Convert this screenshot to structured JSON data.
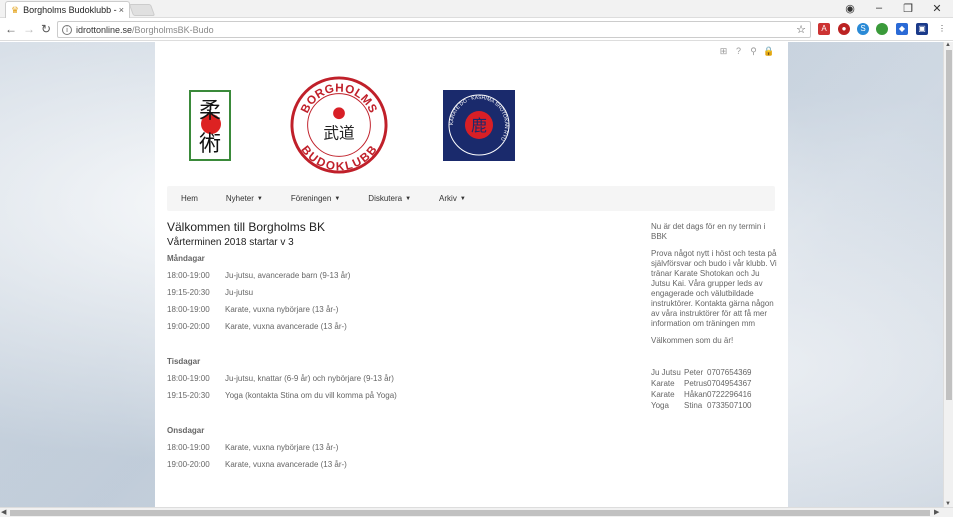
{
  "browser": {
    "tab_title": "Borgholms Budoklubb -",
    "tab_close": "×",
    "url_host": "idrottonline.se",
    "url_path": "/BorgholmsBK-Budo",
    "window_controls": [
      "minimize-icon",
      "maximize-icon",
      "close-icon"
    ]
  },
  "site": {
    "logo_center_top": "BORGHOLMS",
    "logo_center_bottom": "BUDOKLUBB",
    "logo_center_kanji": "武道",
    "logo_left_kanji": [
      "柔",
      "術"
    ],
    "logo_right_outer": "KARATE DO · KASHIMA SHOTOKAN RYU",
    "logo_right_kanji": "鹿",
    "nav": [
      {
        "label": "Hem",
        "caret": ""
      },
      {
        "label": "Nyheter",
        "caret": "▼"
      },
      {
        "label": "Föreningen",
        "caret": "▼"
      },
      {
        "label": "Diskutera",
        "caret": "▼"
      },
      {
        "label": "Arkiv",
        "caret": "▼"
      }
    ]
  },
  "content": {
    "title": "Välkommen till Borgholms BK",
    "subtitle": "Vårterminen 2018 startar v 3",
    "days": [
      {
        "name": "Måndagar",
        "rows": [
          {
            "time": "18:00-19:00",
            "text": "Ju-jutsu, avancerade barn (9-13 år)"
          },
          {
            "time": "19:15-20:30",
            "text": "Ju-jutsu"
          },
          {
            "time": "18:00-19:00",
            "text": "Karate, vuxna nybörjare (13 år-)"
          },
          {
            "time": "19:00-20:00",
            "text": "Karate, vuxna avancerade (13 år-)"
          }
        ]
      },
      {
        "name": "Tisdagar",
        "rows": [
          {
            "time": "18:00-19:00",
            "text": "Ju-jutsu, knattar (6-9 år) och nybörjare (9-13 år)"
          },
          {
            "time": "19:15-20:30",
            "text": "Yoga (kontakta Stina om du vill komma på Yoga)"
          }
        ]
      },
      {
        "name": "Onsdagar",
        "rows": [
          {
            "time": "18:00-19:00",
            "text": "Karate, vuxna nybörjare (13 år-)"
          },
          {
            "time": "19:00-20:00",
            "text": "Karate, vuxna avancerade (13 år-)"
          }
        ]
      }
    ]
  },
  "sidebar": {
    "p1": "Nu är det dags för en ny termin i BBK",
    "p2": "Prova något nytt i höst och testa på självförsvar och budo i vår klubb. Vi tränar Karate Shotokan och Ju Jutsu Kai. Våra grupper leds av engagerade och välutbildade instruktörer. Kontakta gärna någon av våra instruktörer för att få mer information om träningen mm",
    "p3": "Välkommen som du är!",
    "contacts": [
      {
        "sport": "Ju Jutsu",
        "name": "Peter",
        "phone": "0707654369"
      },
      {
        "sport": "Karate",
        "name": "Petrus",
        "phone": "0704954367"
      },
      {
        "sport": "Karate",
        "name": "Håkan",
        "phone": "0722296416"
      },
      {
        "sport": "Yoga",
        "name": "Stina",
        "phone": "0733507100"
      }
    ]
  }
}
